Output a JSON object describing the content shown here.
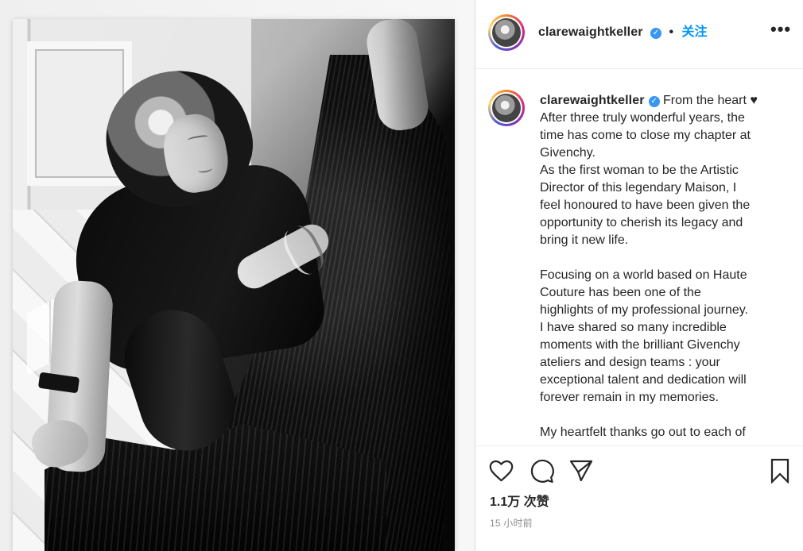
{
  "post": {
    "username": "clarewaightkeller",
    "separator": "•",
    "follow_label": "关注",
    "more_label": "•••",
    "caption_lines": [
      "From the heart ♥",
      "After three truly wonderful years, the",
      "time has come to close my chapter at",
      "Givenchy.",
      "As the first woman to be the Artistic",
      "Director of this legendary Maison, I",
      "feel honoured to have been given the",
      "opportunity to cherish its legacy and",
      "bring it new life.",
      "",
      "Focusing on a world based on Haute",
      "Couture has been one of the",
      "highlights of my professional journey.",
      "I have shared so many incredible",
      "moments with the brilliant Givenchy",
      "ateliers and design teams : your",
      "exceptional talent and dedication will",
      "forever remain in my memories.",
      "",
      "My heartfelt thanks go out to each of"
    ],
    "likes_label": "1.1万 次赞",
    "time_label": "15 小时前"
  },
  "icons": {
    "profile": "avatar-icon",
    "verified": "verified-badge-icon",
    "more": "more-options-icon",
    "like": "heart-icon",
    "comment": "comment-icon",
    "share": "send-icon",
    "save": "bookmark-icon"
  },
  "colors": {
    "accent": "#0095f6",
    "verified": "#3897f0",
    "text": "#262626",
    "secondary": "#8e8e8e",
    "border": "#dbdbdb"
  }
}
